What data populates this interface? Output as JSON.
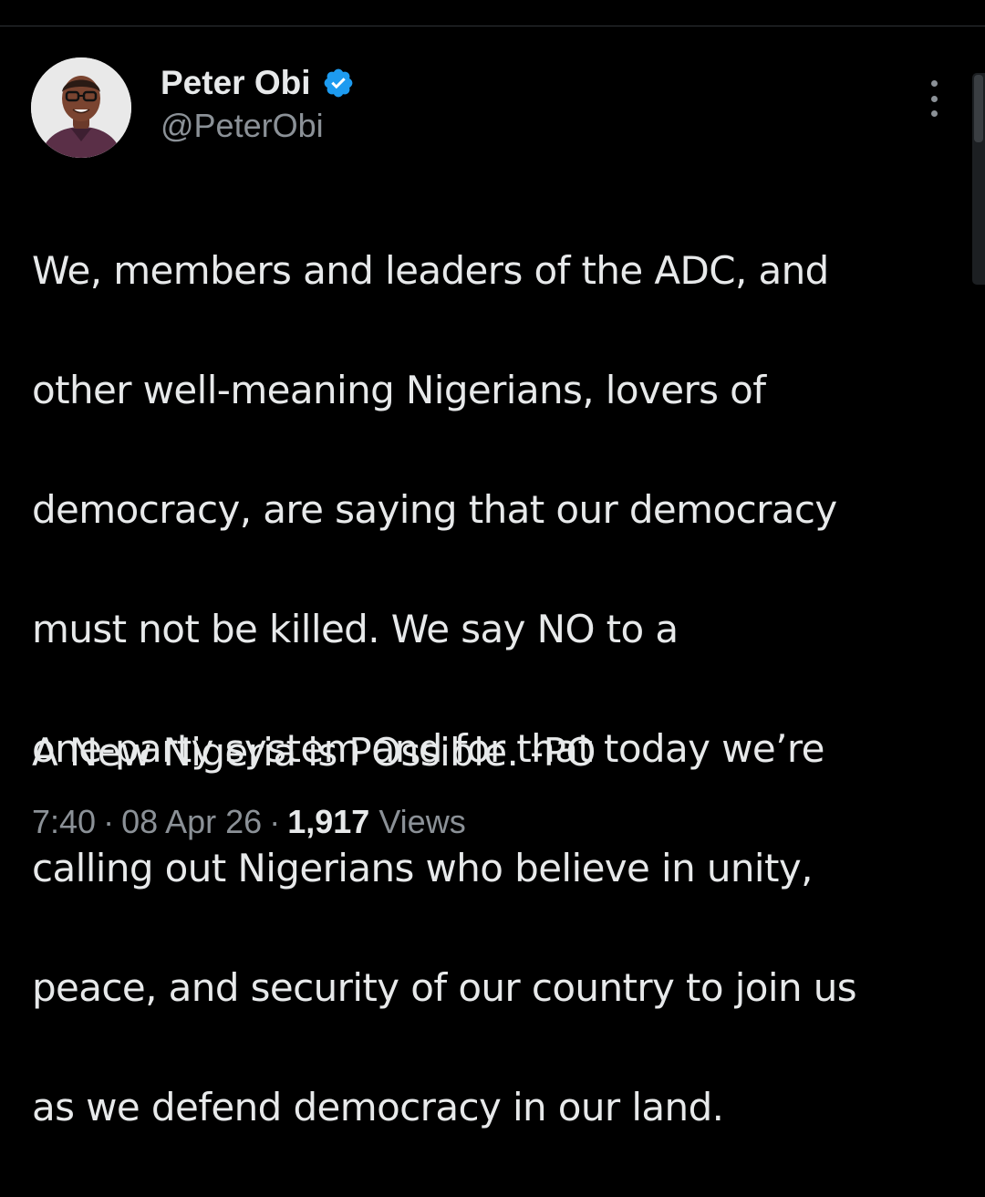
{
  "tweet": {
    "author": {
      "name": "Peter Obi",
      "handle": "@PeterObi",
      "verified": true,
      "avatar_icon": "profile-photo",
      "verified_icon": "verified-badge-icon",
      "verified_color": "#1d9bf0"
    },
    "text_lines": [
      "We, members and leaders of the ADC, and",
      "other well-meaning Nigerians, lovers of",
      "democracy, are saying that our democracy",
      "must not be killed. We say NO to a",
      "one-party system and for that today we’re",
      "calling out Nigerians who believe in unity,",
      "peace, and security of our country to join us",
      "as we defend democracy in our land."
    ],
    "tagline": "A New Nigeria is POssible. -PO",
    "time": "7:40",
    "date": "08 Apr 26",
    "separator": "·",
    "views_count": "1,917",
    "views_label": "Views",
    "more_icon": "more-vertical-icon"
  },
  "colors": {
    "background": "#000000",
    "primary_text": "#e7e9ea",
    "secondary_text": "#8b9197",
    "accent": "#1d9bf0"
  }
}
